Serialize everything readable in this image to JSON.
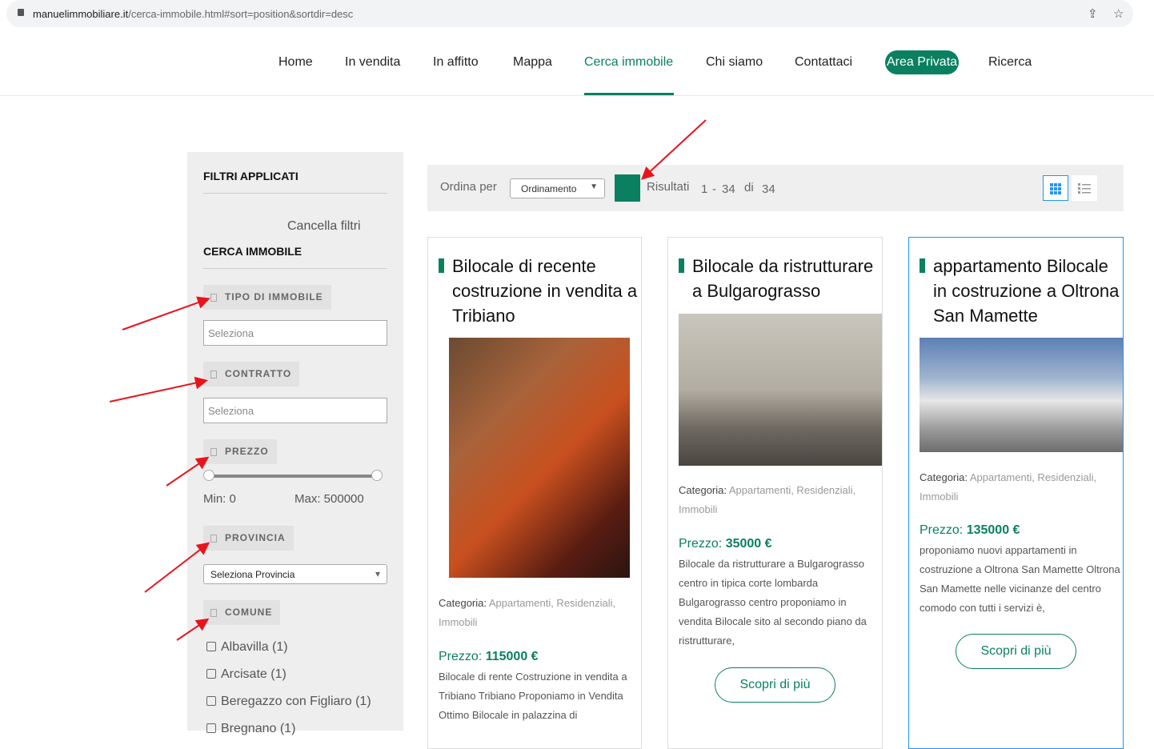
{
  "browser": {
    "url_domain": "manuelimmobiliare.it",
    "url_path": "/cerca-immobile.html#sort=position&sortdir=desc"
  },
  "nav": {
    "items": [
      "Home",
      "In vendita",
      "In affitto",
      "Mappa",
      "Cerca immobile",
      "Chi siamo",
      "Contattaci",
      "Area Privata",
      "Ricerca"
    ]
  },
  "sidebar": {
    "applied_title": "FILTRI APPLICATI",
    "clear": "Cancella filtri",
    "search_title": "CERCA IMMOBILE",
    "filters": {
      "tipo": "TIPO DI IMMOBILE",
      "contratto": "CONTRATTO",
      "prezzo": "PREZZO",
      "provincia": "PROVINCIA",
      "comune": "COMUNE"
    },
    "select_placeholder": "Seleziona",
    "province_select": "Seleziona Provincia",
    "min": "Min: 0",
    "max": "Max: 500000",
    "price_range": {
      "min": 0,
      "max": 500000
    },
    "comuni": [
      "Albavilla (1)",
      "Arcisate (1)",
      "Beregazzo con Figliaro (1)",
      "Bregnano (1)"
    ]
  },
  "toolbar": {
    "sort_label": "Ordina per",
    "sort_value": "Ordinamento",
    "results_label": "Risultati",
    "from": "1",
    "dash": "-",
    "to": "34",
    "of": "di",
    "total": "34"
  },
  "cards": [
    {
      "title": "Bilocale di recente costruzione in vendita a Tribiano",
      "cat_label": "Categoria:",
      "categories": "Appartamenti, Residenziali, Immobili",
      "price_label": "Prezzo:",
      "price": "115000 €",
      "desc": "Bilocale di rente Costruzione in vendita a Tribiano  Tribiano Proponiamo in Vendita Ottimo Bilocale in palazzina di"
    },
    {
      "title": "Bilocale da ristrutturare a Bulgarograsso",
      "cat_label": "Categoria:",
      "categories": "Appartamenti, Residenziali, Immobili",
      "price_label": "Prezzo:",
      "price": "35000 €",
      "desc": "Bilocale da ristrutturare a Bulgarograsso centro in tipica corte lombarda Bulgarograsso centro proponiamo in vendita Bilocale sito al secondo piano da ristrutturare,",
      "button": "Scopri di più"
    },
    {
      "title": "appartamento Bilocale in costruzione a Oltrona San Mamette",
      "cat_label": "Categoria:",
      "categories": "Appartamenti, Residenziali, Immobili",
      "price_label": "Prezzo:",
      "price": "135000 €",
      "desc": "proponiamo nuovi appartamenti in costruzione a Oltrona San Mamette Oltrona San Mamette nelle vicinanze del centro comodo con tutti i servizi è,",
      "button": "Scopri di più"
    }
  ]
}
